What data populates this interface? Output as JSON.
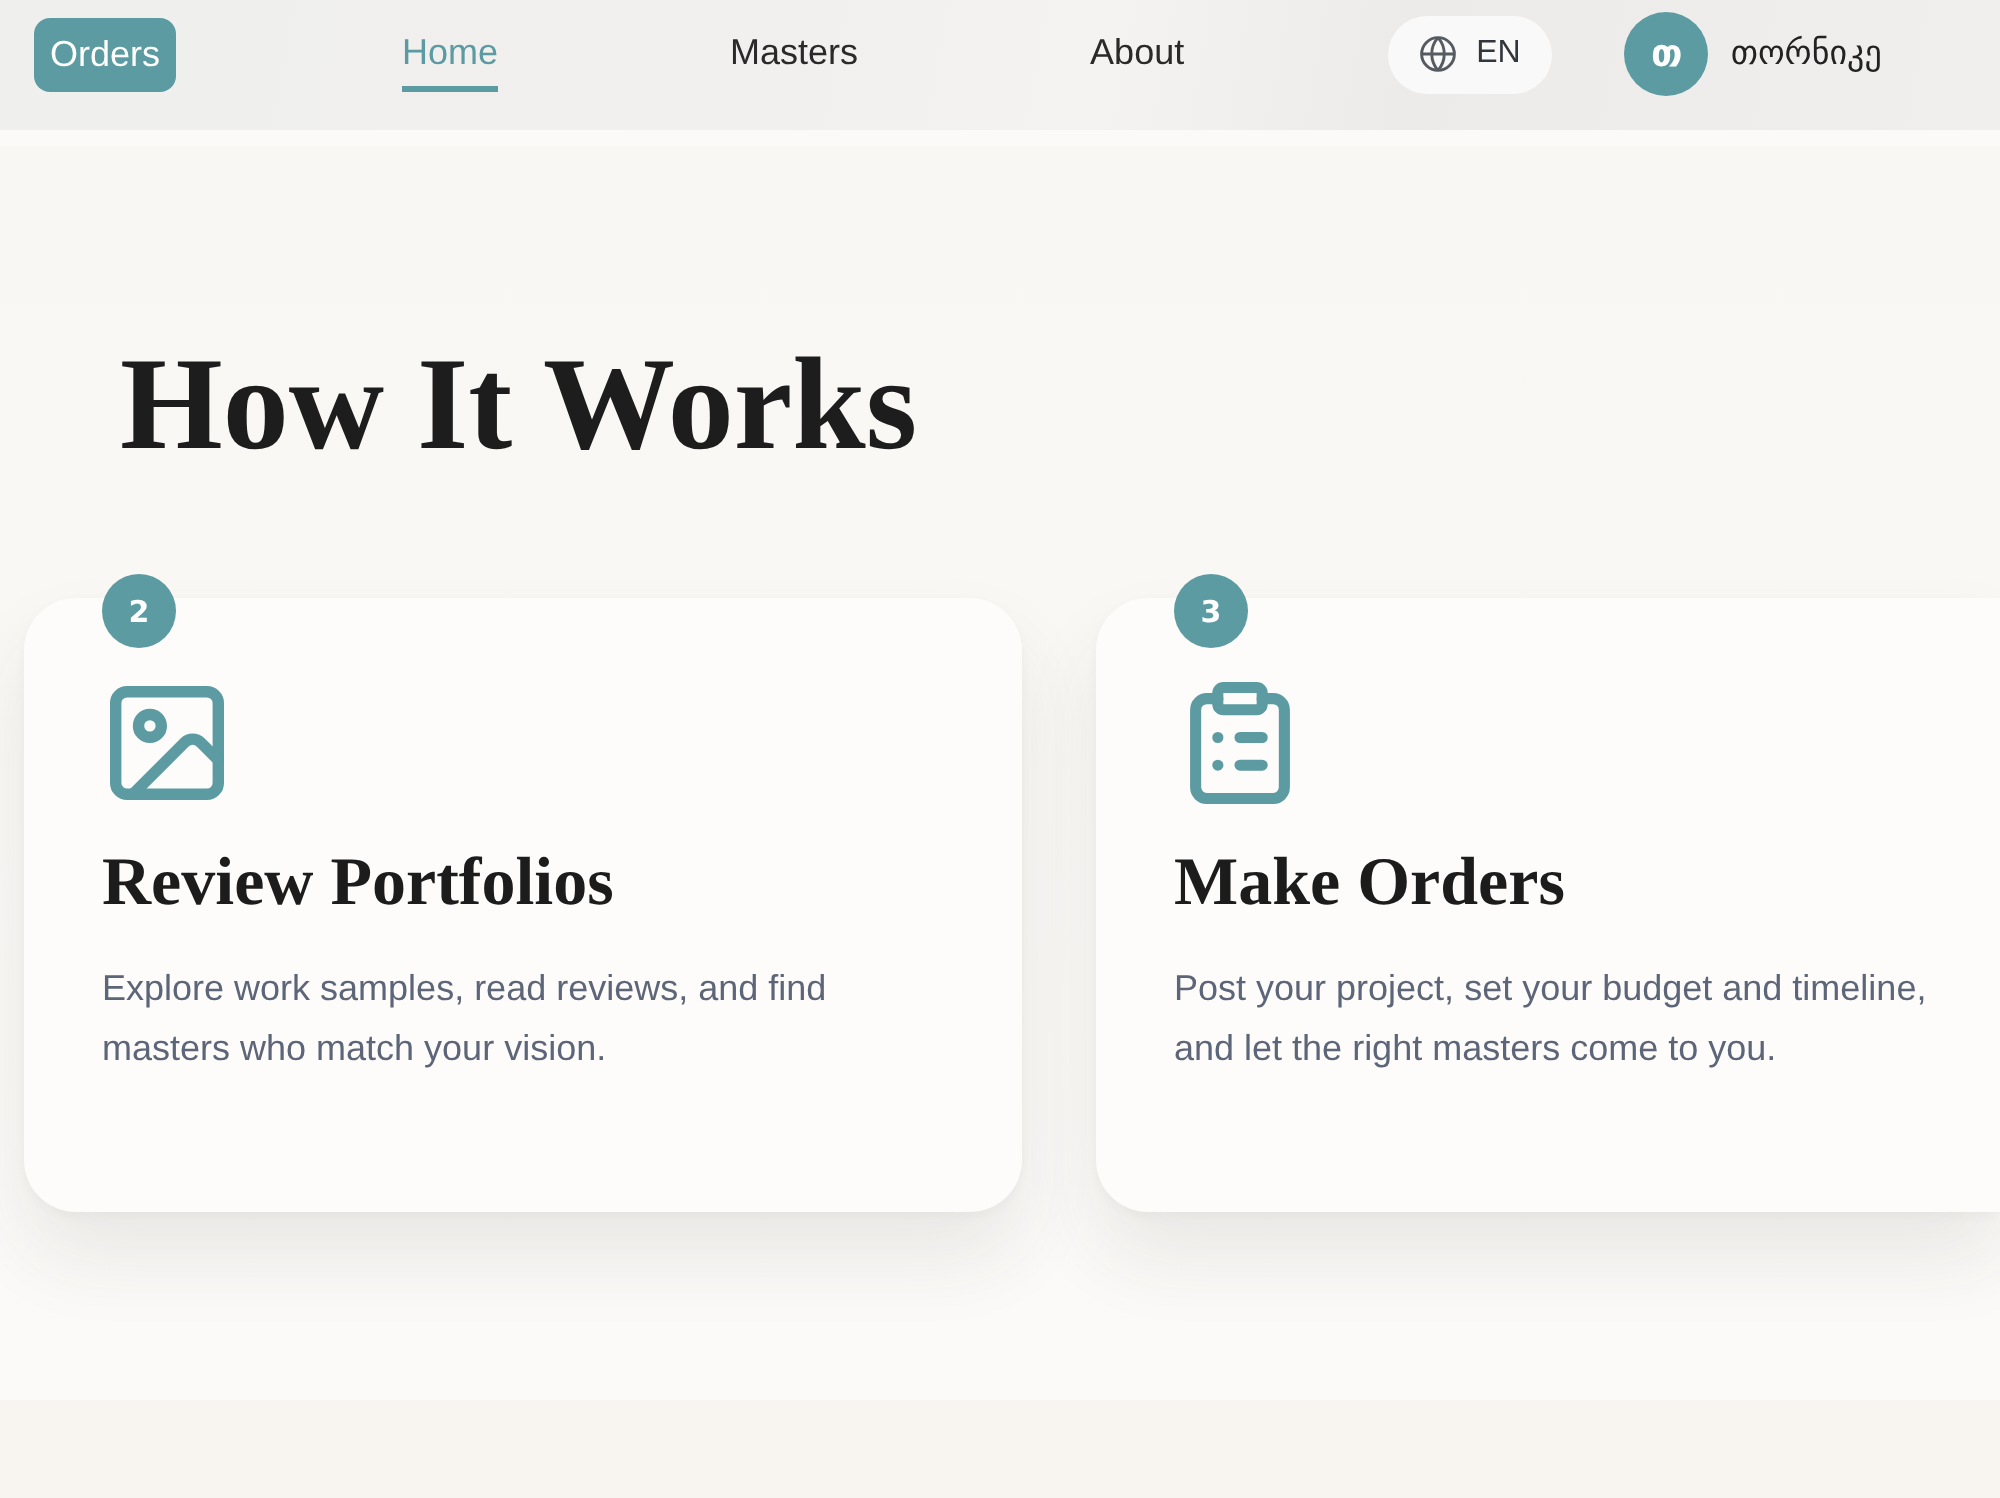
{
  "header": {
    "logo": "Orders",
    "nav": [
      {
        "label": "Home",
        "selected": true
      },
      {
        "label": "Masters",
        "selected": false
      },
      {
        "label": "About",
        "selected": false
      }
    ],
    "language": "EN",
    "user": {
      "initial": "თ",
      "name": "თორნიკე"
    }
  },
  "section": {
    "title": "How It Works",
    "steps": [
      {
        "number": "2",
        "kind": "image",
        "title": "Review Portfolios",
        "description": "Explore work samples, read reviews, and find masters who match your vision."
      },
      {
        "number": "3",
        "kind": "checklist",
        "title": "Make Orders",
        "description": "Post your project, set your budget and timeline, and let the right masters come to you."
      }
    ]
  }
}
